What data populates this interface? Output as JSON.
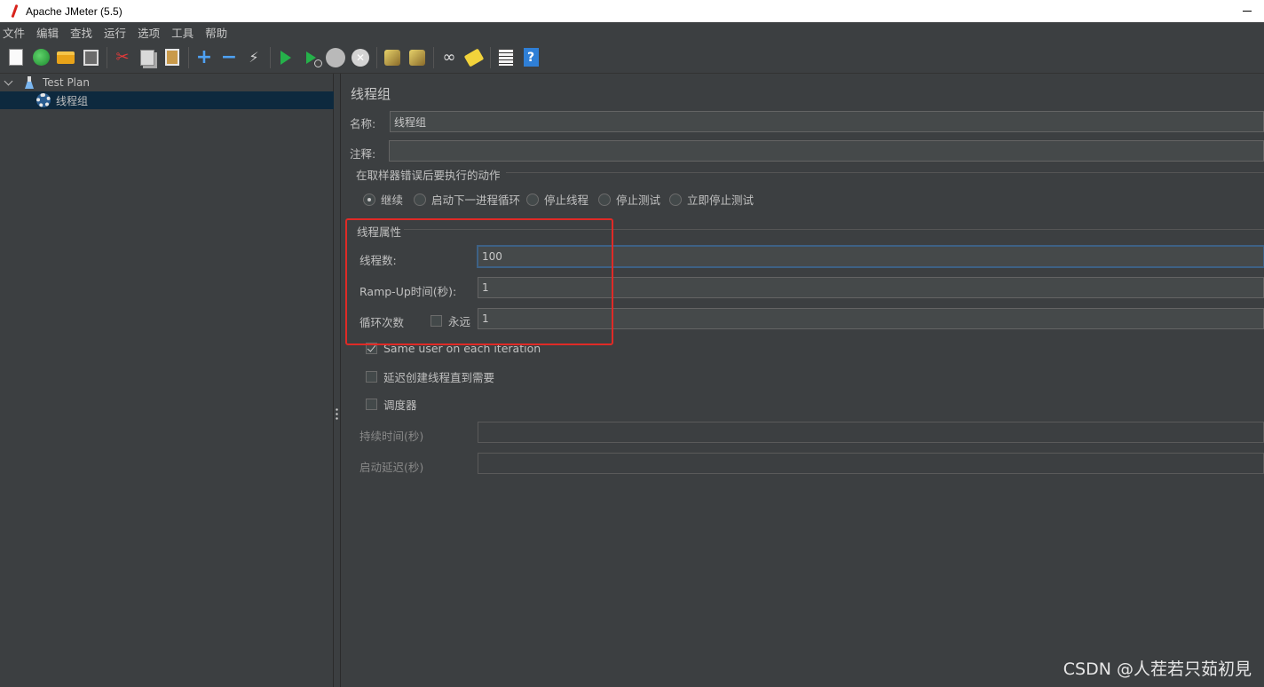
{
  "window": {
    "title": "Apache JMeter (5.5)"
  },
  "menu": [
    "文件",
    "编辑",
    "查找",
    "运行",
    "选项",
    "工具",
    "帮助"
  ],
  "tree": {
    "root": "Test Plan",
    "child": "线程组"
  },
  "panel": {
    "title": "线程组",
    "name_label": "名称:",
    "name_value": "线程组",
    "comment_label": "注释:",
    "comment_value": "",
    "error_section": "在取样器错误后要执行的动作",
    "error_actions": [
      "继续",
      "启动下一进程循环",
      "停止线程",
      "停止测试",
      "立即停止测试"
    ],
    "error_selected_index": 0,
    "thread_section": "线程属性",
    "threads_label": "线程数:",
    "threads_value": "100",
    "rampup_label": "Ramp-Up时间(秒):",
    "rampup_value": "1",
    "loop_label": "循环次数",
    "forever_label": "永远",
    "forever_checked": false,
    "loop_value": "1",
    "same_user_label": "Same user on each iteration",
    "same_user_checked": true,
    "delay_label": "延迟创建线程直到需要",
    "delay_checked": false,
    "scheduler_label": "调度器",
    "scheduler_checked": false,
    "duration_label": "持续时间(秒)",
    "duration_value": "",
    "startup_delay_label": "启动延迟(秒)",
    "startup_delay_value": ""
  },
  "watermark": "CSDN @人茬若只茹初見",
  "colors": {
    "highlight": "#e02a26",
    "tree_selected": "#0d293e",
    "background": "#3c3f41"
  }
}
